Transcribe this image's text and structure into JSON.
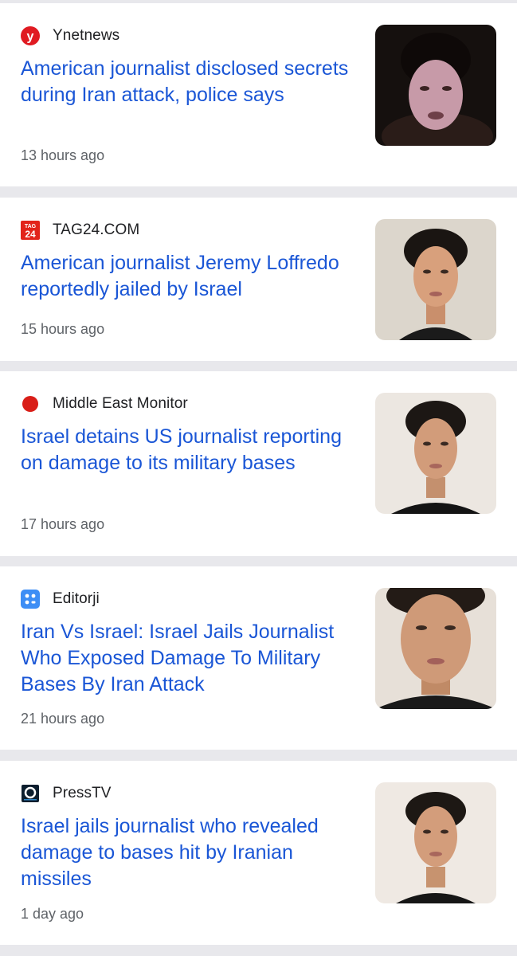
{
  "articles": [
    {
      "source": "Ynetnews",
      "source_icon": "ynetnews-logo-icon",
      "headline": "American journalist disclosed secrets during Iran attack, police says",
      "time": "13 hours ago",
      "thumbnail": "journalist-photo"
    },
    {
      "source": "TAG24.COM",
      "source_icon": "tag24-logo-icon",
      "icon_text": "TAG 24",
      "headline": "American journalist Jeremy Loffredo reportedly jailed by Israel",
      "time": "15 hours ago",
      "thumbnail": "journalist-photo"
    },
    {
      "source": "Middle East Monitor",
      "source_icon": "middle-east-monitor-logo-icon",
      "headline": "Israel detains US journalist reporting on damage to its military bases",
      "time": "17 hours ago",
      "thumbnail": "journalist-photo"
    },
    {
      "source": "Editorji",
      "source_icon": "editorji-logo-icon",
      "headline": "Iran Vs Israel: Israel Jails Journalist Who Exposed Damage To Military Bases By Iran Attack",
      "time": "21 hours ago",
      "thumbnail": "journalist-photo"
    },
    {
      "source": "PressTV",
      "source_icon": "presstv-logo-icon",
      "headline": "Israel jails journalist who revealed damage to bases hit by Iranian missiles",
      "time": "1 day ago",
      "thumbnail": "journalist-photo"
    }
  ],
  "colors": {
    "headline": "#1a56d6",
    "source": "#202124",
    "time": "#5f6368",
    "divider": "#e8e8ec",
    "ynet_red": "#e01b22",
    "mem_red": "#d91e18",
    "editorji_blue": "#3d8ef5"
  }
}
